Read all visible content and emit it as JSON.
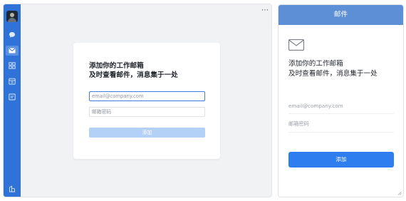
{
  "sidebar": {
    "items": [
      {
        "icon": "chat-icon"
      },
      {
        "icon": "mail-icon",
        "active": true
      },
      {
        "icon": "apps-grid-icon"
      },
      {
        "icon": "calendar-icon"
      },
      {
        "icon": "docs-icon"
      },
      {
        "icon": "help-icon"
      }
    ],
    "accent_color": "#2f73d9"
  },
  "main": {
    "more_label": "⋯",
    "card": {
      "title_line1": "添加你的工作邮箱",
      "title_line2": "及时查看邮件，消息集于一处",
      "email_placeholder": "email@company.com",
      "password_placeholder": "邮箱密码",
      "add_label": "添加"
    }
  },
  "mobile": {
    "header_title": "邮件",
    "title_line1": "添加你的工作邮箱",
    "title_line2": "及时查看邮件，消息集于一处",
    "email_placeholder": "email@company.com",
    "password_placeholder": "邮箱密码",
    "add_label": "添加",
    "header_color": "#5d8fd6",
    "button_color": "#2f7ef0"
  }
}
